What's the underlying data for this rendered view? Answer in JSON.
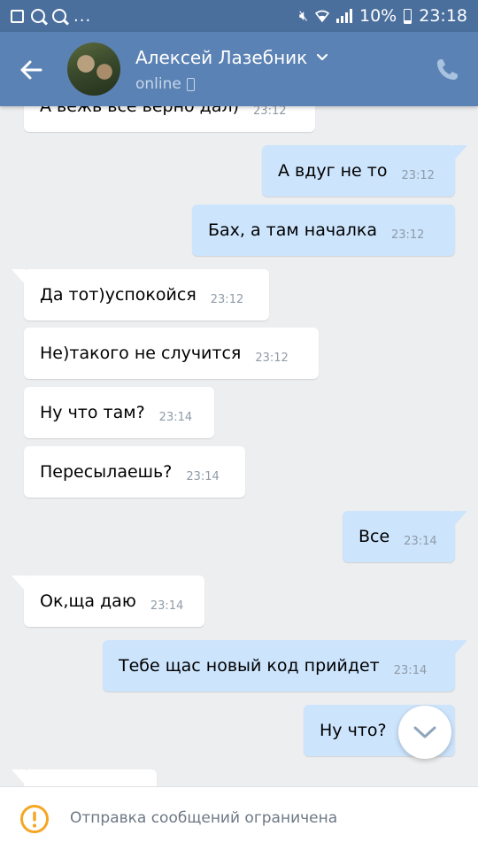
{
  "status_bar": {
    "battery_percent": "10%",
    "time": "23:18",
    "notification_overflow": "..."
  },
  "header": {
    "contact_name": "Алексей Лазебник",
    "status": "online",
    "icons": {
      "back": "arrow-left-icon",
      "avatar": "avatar",
      "dropdown": "chevron-down-icon",
      "device": "mobile-phone-icon",
      "call": "phone-icon"
    }
  },
  "messages": [
    {
      "text": "А вежь все верно дал)",
      "time": "23:12",
      "direction": "in"
    },
    {
      "text": "А вдуг не то",
      "time": "23:12",
      "direction": "out"
    },
    {
      "text": "Бах, а там началка",
      "time": "23:12",
      "direction": "out"
    },
    {
      "text": "Да тот)успокойся",
      "time": "23:12",
      "direction": "in"
    },
    {
      "text": "Не)такого не случится",
      "time": "23:12",
      "direction": "in"
    },
    {
      "text": "Ну что там?",
      "time": "23:14",
      "direction": "in"
    },
    {
      "text": "Пересылаешь?",
      "time": "23:14",
      "direction": "in"
    },
    {
      "text": "Все",
      "time": "23:14",
      "direction": "out"
    },
    {
      "text": "Ок,ща даю",
      "time": "23:14",
      "direction": "in"
    },
    {
      "text": "Тебе щас новый код прийдет",
      "time": "23:14",
      "direction": "out"
    },
    {
      "text": "Ну что?",
      "time": "",
      "direction": "out"
    },
    {
      "text": "",
      "time": "",
      "direction": "in"
    }
  ],
  "scroll_button": {
    "icon": "chevron-down-icon"
  },
  "notice": {
    "icon": "warning-icon",
    "text": "Отправка сообщений ограничена"
  },
  "colors": {
    "status_bar": "#4a6f9c",
    "header": "#5b82b4",
    "background": "#edeef0",
    "incoming_bubble": "#ffffff",
    "outgoing_bubble": "#cce4fc",
    "warning": "#f5a623"
  }
}
